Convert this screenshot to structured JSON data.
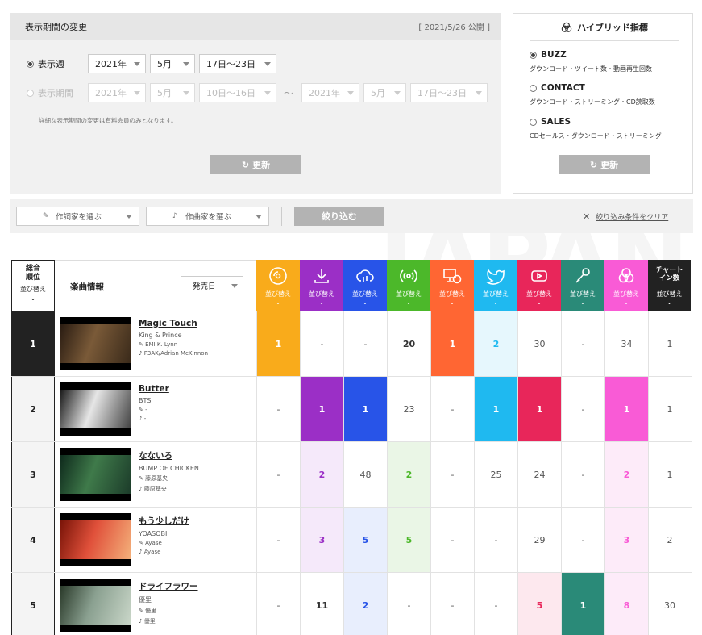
{
  "period": {
    "title": "表示期間の変更",
    "published": "[ 2021/5/26 公開 ]",
    "week_label": "表示週",
    "week": {
      "year": "2021年",
      "month": "5月",
      "range": "17日〜23日"
    },
    "range_label": "表示期間",
    "range_from": {
      "year": "2021年",
      "month": "5月",
      "range": "10日〜16日"
    },
    "tilde": "〜",
    "range_to": {
      "year": "2021年",
      "month": "5月",
      "range": "17日〜23日"
    },
    "note": "詳細な表示期間の変更は有料会員のみとなります。",
    "update_label": "更新"
  },
  "hybrid": {
    "title": "ハイブリッド指標",
    "options": [
      {
        "name": "BUZZ",
        "desc": "ダウンロード・ツイート数・動画再生回数",
        "selected": true
      },
      {
        "name": "CONTACT",
        "desc": "ダウンロード・ストリーミング・CD読取数",
        "selected": false
      },
      {
        "name": "SALES",
        "desc": "CDセールス・ダウンロード・ストリーミング",
        "selected": false
      }
    ],
    "update_label": "更新"
  },
  "filter": {
    "lyricist_label": "作詞家を選ぶ",
    "composer_label": "作曲家を選ぶ",
    "narrow_label": "絞り込む",
    "clear_label": "絞り込み条件をクリア"
  },
  "watermark": "JAPAN",
  "table": {
    "rank_header": [
      "総合",
      "順位"
    ],
    "sort_label": "並び替え",
    "info_header": "楽曲情報",
    "release_sort": "発売日",
    "chart_in_header": [
      "チャート",
      "イン数"
    ],
    "columns": [
      {
        "icon": "cd-icon",
        "color": "#f9ab1b",
        "light": "#fef2dc"
      },
      {
        "icon": "download-icon",
        "color": "#9b2fc6",
        "light": "#f5e9fa"
      },
      {
        "icon": "streaming-icon",
        "color": "#2854e8",
        "light": "#e8eefd"
      },
      {
        "icon": "radio-icon",
        "color": "#4cb82a",
        "light": "#eaf6e6"
      },
      {
        "icon": "pc-cd-icon",
        "color": "#ff6633",
        "light": "#ffece4"
      },
      {
        "icon": "twitter-icon",
        "color": "#1fb9f0",
        "light": "#e6f7fd"
      },
      {
        "icon": "youtube-icon",
        "color": "#e8265a",
        "light": "#fde8ee"
      },
      {
        "icon": "karaoke-icon",
        "color": "#2a8a78",
        "light": "#e6f2f0"
      },
      {
        "icon": "hybrid-icon",
        "color": "#f95bd6",
        "light": "#fdebf9"
      }
    ],
    "rows": [
      {
        "rank": "1",
        "title": "Magic Touch",
        "artist": "King & Prince",
        "lyricist": "EMI K. Lynn",
        "composer": "P3AK/Adrian McKinnon",
        "cells": [
          "1",
          "-",
          "-",
          "20",
          "1",
          "2",
          "30",
          "-",
          "34"
        ],
        "hl": [
          1,
          0,
          0,
          0,
          1,
          2,
          0,
          0,
          0
        ],
        "bold": [
          1,
          0,
          0,
          1,
          1,
          1,
          0,
          0,
          0
        ],
        "chart_in": "1",
        "thumb": [
          "#2a1c12",
          "#7a5a38",
          "#3a2a1a"
        ]
      },
      {
        "rank": "2",
        "title": "Butter",
        "artist": "BTS",
        "lyricist": "-",
        "composer": "-",
        "cells": [
          "-",
          "1",
          "1",
          "23",
          "-",
          "1",
          "1",
          "-",
          "1"
        ],
        "hl": [
          0,
          1,
          1,
          0,
          0,
          1,
          1,
          0,
          1
        ],
        "bold": [
          0,
          1,
          1,
          0,
          0,
          1,
          1,
          0,
          1
        ],
        "chart_in": "1",
        "thumb": [
          "#1a1a1a",
          "#e6e6e6",
          "#444444"
        ]
      },
      {
        "rank": "3",
        "title": "なないろ",
        "artist": "BUMP OF CHICKEN",
        "lyricist": "藤原基央",
        "composer": "藤原基央",
        "cells": [
          "-",
          "2",
          "48",
          "2",
          "-",
          "25",
          "24",
          "-",
          "2"
        ],
        "hl": [
          0,
          2,
          0,
          2,
          0,
          0,
          0,
          0,
          2
        ],
        "bold": [
          0,
          1,
          0,
          1,
          0,
          0,
          0,
          0,
          1
        ],
        "chart_in": "1",
        "thumb": [
          "#0e2a1c",
          "#3f7a4a",
          "#1c3c2a"
        ]
      },
      {
        "rank": "4",
        "title": "もう少しだけ",
        "artist": "YOASOBI",
        "lyricist": "Ayase",
        "composer": "Ayase",
        "cells": [
          "-",
          "3",
          "5",
          "5",
          "-",
          "-",
          "29",
          "-",
          "3"
        ],
        "hl": [
          0,
          2,
          2,
          2,
          0,
          0,
          0,
          0,
          2
        ],
        "bold": [
          0,
          1,
          1,
          1,
          0,
          0,
          0,
          0,
          1
        ],
        "chart_in": "2",
        "thumb": [
          "#7a1408",
          "#e0503a",
          "#f4b07a"
        ]
      },
      {
        "rank": "5",
        "title": "ドライフラワー",
        "artist": "優里",
        "lyricist": "優里",
        "composer": "優里",
        "cells": [
          "-",
          "11",
          "2",
          "-",
          "-",
          "-",
          "5",
          "1",
          "8"
        ],
        "hl": [
          0,
          0,
          2,
          0,
          0,
          0,
          2,
          1,
          2
        ],
        "bold": [
          0,
          1,
          1,
          0,
          0,
          0,
          1,
          1,
          1
        ],
        "chart_in": "30",
        "thumb": [
          "#2a3a2a",
          "#8aa090",
          "#c9d6c8"
        ]
      }
    ]
  }
}
